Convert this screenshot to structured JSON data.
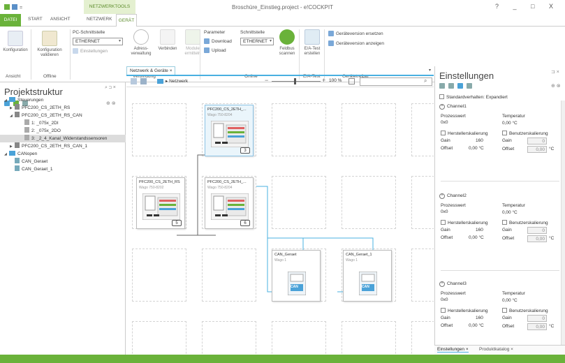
{
  "window": {
    "title": "Broschüre_Einstieg.project - e!COCKPIT",
    "context_tab": "NETZWERKTOOLS",
    "help": "?",
    "minimize": "_",
    "maximize": "□",
    "close": "X"
  },
  "ribbon_tabs": [
    "DATEI",
    "START",
    "ANSICHT",
    "NETZWERK",
    "GERÄT"
  ],
  "ribbon": {
    "groups": {
      "ansicht": "Ansicht",
      "offline": "Offline",
      "verbindung": "Verbindung",
      "online": "Online",
      "ea_test": "E/A-Test",
      "geraetetreiber": "Gerätetreiber"
    },
    "konfiguration": "Konfiguration",
    "konfiguration_validieren": "Konfiguration validieren",
    "pc_schnittstelle": "PC-Schnittstelle",
    "pc_schnittstelle_value": "ETHERNET",
    "einstellungen": "Einstellungen",
    "adress_verwaltung": "Adress-verwaltung",
    "verbinden": "Verbinden",
    "module_ermitteln": "Module ermitteln",
    "parameter": "Parameter",
    "download": "Download",
    "upload": "Upload",
    "schnittstelle": "Schnittstelle",
    "schnittstelle_value": "ETHERNET",
    "feldbus_scannen": "Feldbus scannen",
    "ea_test_erstellen": "E/A-Test erstellen",
    "geraeteversion_ersetzen": "Geräteversion ersetzen",
    "geraeteversion_anzeigen": "Geräteversion anzeigen"
  },
  "left_panel": {
    "title": "Projektstruktur",
    "tree": [
      {
        "label": "Steuerungen",
        "level": 0,
        "type": "folder",
        "expanded": true
      },
      {
        "label": "PFC200_CS_2ETH_RS",
        "level": 1,
        "type": "device",
        "expanded": false
      },
      {
        "label": "PFC200_CS_2ETH_RS_CAN",
        "level": 1,
        "type": "device",
        "expanded": true
      },
      {
        "label": "1: _075x_2DI",
        "level": 2,
        "type": "module"
      },
      {
        "label": "2: _075x_2DO",
        "level": 2,
        "type": "module"
      },
      {
        "label": "3: _2_4_Kanal_Widerstandssensoren",
        "level": 2,
        "type": "module",
        "selected": true
      },
      {
        "label": "PFC200_CS_2ETH_RS_CAN_1",
        "level": 1,
        "type": "device",
        "expanded": false
      },
      {
        "label": "CANopen",
        "level": 0,
        "type": "folder",
        "expanded": true
      },
      {
        "label": "CAN_Geraet",
        "level": 1,
        "type": "candevice"
      },
      {
        "label": "CAN_Geraet_1",
        "level": 1,
        "type": "candevice"
      }
    ]
  },
  "center": {
    "tab": "Netzwerk & Geräte",
    "breadcrumb": "Netzwerk",
    "zoom": "100 %",
    "nodes": [
      {
        "title": "PFC200_CS_2ETH_...",
        "subtitle": "Wago 750-8204",
        "number": "3",
        "selected": true
      },
      {
        "title": "PFC200_CS_2ETH_RS",
        "subtitle": "Wago 750-8202",
        "number": "5"
      },
      {
        "title": "PFC200_CS_2ETH_...",
        "subtitle": "Wago 750-8204",
        "number": "6"
      },
      {
        "title": "CAN_Geraet",
        "subtitle": "Wago 1",
        "icon_label": "CAN"
      },
      {
        "title": "CAN_Geraet_1",
        "subtitle": "Wago 1",
        "icon_label": "CAN"
      }
    ]
  },
  "right_panel": {
    "title": "Einstellungen",
    "standard_label": "Standardverhalten: Expandiert",
    "channels": [
      {
        "name": "Channel1",
        "prozesswert_label": "Prozesswert",
        "prozesswert": "0x0",
        "temperatur_label": "Temperatur",
        "temperatur": "0,00 °C",
        "hersteller": "Herstellerskalierung",
        "benutzer": "Benutzerskalierung",
        "gain_label": "Gain",
        "gain": "160",
        "gain_user": "0",
        "offset_label": "Offset",
        "offset": "0,00 °C",
        "offset_user": "0,00",
        "offset_unit": "°C"
      },
      {
        "name": "Channel2",
        "prozesswert_label": "Prozesswert",
        "prozesswert": "0x0",
        "temperatur_label": "Temperatur",
        "temperatur": "0,00 °C",
        "hersteller": "Herstellerskalierung",
        "benutzer": "Benutzerskalierung",
        "gain_label": "Gain",
        "gain": "160",
        "gain_user": "0",
        "offset_label": "Offset",
        "offset": "0,00 °C",
        "offset_user": "0,00",
        "offset_unit": "°C"
      },
      {
        "name": "Channel3",
        "prozesswert_label": "Prozesswert",
        "prozesswert": "0x0",
        "temperatur_label": "Temperatur",
        "temperatur": "0,00 °C",
        "hersteller": "Herstellerskalierung",
        "benutzer": "Benutzerskalierung",
        "gain_label": "Gain",
        "gain": "160",
        "gain_user": "0",
        "offset_label": "Offset",
        "offset": "0,00 °C",
        "offset_user": "0,00",
        "offset_unit": "°C"
      }
    ],
    "bottom_tabs": [
      "Einstellungen",
      "Produktkatalog"
    ]
  },
  "colors": {
    "accent_green": "#6ab23a",
    "accent_blue": "#49b0e0",
    "folder_blue": "#4aa2d8"
  }
}
